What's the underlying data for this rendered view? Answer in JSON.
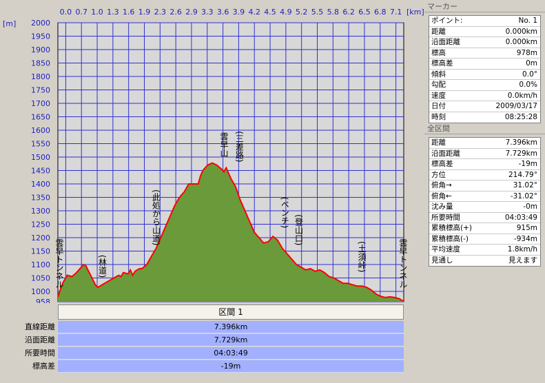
{
  "chart_data": {
    "type": "area",
    "x_unit": "[km]",
    "y_unit": "[m]",
    "x_ticks": [
      "0.0",
      "0.7",
      "1.0",
      "1.3",
      "1.6",
      "1.9",
      "2.3",
      "2.6",
      "2.9",
      "3.3",
      "3.6",
      "3.9",
      "4.2",
      "4.5",
      "4.9",
      "5.2",
      "5.5",
      "5.8",
      "6.2",
      "6.5",
      "6.8",
      "7.1"
    ],
    "y_ticks": [
      2000,
      1950,
      1900,
      1850,
      1800,
      1750,
      1700,
      1650,
      1600,
      1550,
      1500,
      1450,
      1400,
      1350,
      1300,
      1250,
      1200,
      1150,
      1100,
      1050,
      1000,
      958
    ],
    "xlim": [
      0,
      7.396
    ],
    "ylim": [
      958,
      2000
    ],
    "x": [
      0.0,
      0.1,
      0.2,
      0.3,
      0.4,
      0.5,
      0.55,
      0.6,
      0.7,
      0.8,
      0.85,
      0.9,
      1.0,
      1.1,
      1.2,
      1.3,
      1.35,
      1.4,
      1.5,
      1.55,
      1.6,
      1.65,
      1.7,
      1.75,
      1.8,
      1.9,
      2.0,
      2.1,
      2.2,
      2.3,
      2.4,
      2.5,
      2.6,
      2.7,
      2.8,
      2.9,
      3.0,
      3.05,
      3.1,
      3.2,
      3.3,
      3.4,
      3.5,
      3.55,
      3.6,
      3.65,
      3.7,
      3.8,
      3.9,
      4.0,
      4.1,
      4.2,
      4.3,
      4.4,
      4.5,
      4.6,
      4.7,
      4.8,
      4.85,
      4.9,
      5.0,
      5.1,
      5.2,
      5.3,
      5.4,
      5.5,
      5.6,
      5.7,
      5.8,
      5.9,
      6.0,
      6.1,
      6.2,
      6.3,
      6.4,
      6.5,
      6.6,
      6.7,
      6.8,
      6.9,
      7.0,
      7.1,
      7.2,
      7.3,
      7.396
    ],
    "y": [
      978,
      1030,
      1060,
      1055,
      1070,
      1090,
      1100,
      1095,
      1060,
      1025,
      1015,
      1020,
      1030,
      1040,
      1050,
      1060,
      1055,
      1070,
      1065,
      1080,
      1060,
      1075,
      1080,
      1085,
      1085,
      1100,
      1130,
      1160,
      1200,
      1240,
      1280,
      1320,
      1350,
      1370,
      1400,
      1400,
      1400,
      1430,
      1450,
      1470,
      1478,
      1470,
      1455,
      1445,
      1460,
      1440,
      1420,
      1390,
      1340,
      1300,
      1260,
      1220,
      1200,
      1180,
      1185,
      1205,
      1190,
      1160,
      1150,
      1140,
      1120,
      1100,
      1090,
      1080,
      1085,
      1075,
      1080,
      1070,
      1055,
      1050,
      1040,
      1030,
      1030,
      1025,
      1020,
      1020,
      1015,
      1005,
      990,
      980,
      975,
      978,
      975,
      970,
      959
    ],
    "annotations": [
      {
        "x": 0.03,
        "y": 990,
        "label": "雲早トンネル"
      },
      {
        "x": 0.95,
        "y": 1030,
        "label": "(林道)"
      },
      {
        "x": 2.1,
        "y": 1150,
        "label": "(此処から山道)"
      },
      {
        "x": 3.55,
        "y": 1480,
        "label": "雲早山"
      },
      {
        "x": 3.88,
        "y": 1460,
        "label": "(三差路)"
      },
      {
        "x": 4.85,
        "y": 1215,
        "label": "(ベンチ)"
      },
      {
        "x": 5.15,
        "y": 1150,
        "label": "(登山口)"
      },
      {
        "x": 6.5,
        "y": 1050,
        "label": "(土須峠)"
      },
      {
        "x": 7.38,
        "y": 990,
        "label": "雲早トンネル"
      }
    ]
  },
  "summary": {
    "header": "区間 1",
    "rows": [
      {
        "label": "直線距離",
        "value": "7.396km"
      },
      {
        "label": "沿面距離",
        "value": "7.729km"
      },
      {
        "label": "所要時間",
        "value": "04:03:49"
      },
      {
        "label": "標高差",
        "value": "-19m"
      }
    ]
  },
  "marker_panel": {
    "title": "マーカー",
    "rows": [
      {
        "label": "ポイント:",
        "value": "No. 1"
      },
      {
        "label": "距離",
        "value": "0.000km"
      },
      {
        "label": "沿面距離",
        "value": "0.000km"
      },
      {
        "label": "標高",
        "value": "978m"
      },
      {
        "label": "標高差",
        "value": "0m"
      },
      {
        "label": "傾斜",
        "value": "0.0°"
      },
      {
        "label": "勾配",
        "value": "0.0%"
      },
      {
        "label": "速度",
        "value": "0.0km/h"
      },
      {
        "label": "日付",
        "value": "2009/03/17"
      },
      {
        "label": "時刻",
        "value": "08:25:28"
      }
    ]
  },
  "section_panel": {
    "title": "全区間",
    "rows": [
      {
        "label": "距離",
        "value": "7.396km"
      },
      {
        "label": "沿面距離",
        "value": "7.729km"
      },
      {
        "label": "標高差",
        "value": "-19m"
      },
      {
        "label": "方位",
        "value": "214.79°"
      },
      {
        "label": "俯角→",
        "value": "31.02°"
      },
      {
        "label": "俯角←",
        "value": "-31.02°"
      },
      {
        "label": "沈み量",
        "value": "-0m"
      },
      {
        "label": "所要時間",
        "value": "04:03:49"
      },
      {
        "label": "累積標高(+)",
        "value": "915m"
      },
      {
        "label": "累積標高(-)",
        "value": "-934m"
      },
      {
        "label": "平均速度",
        "value": "1.8km/h"
      },
      {
        "label": "見通し",
        "value": "見えます"
      }
    ]
  },
  "colors": {
    "plot_bg": "#d8d8d8",
    "grid": "#3030d0",
    "fill": "#6a9a3a",
    "line": "#ff0000",
    "axis_text": "#2020c0",
    "summary_bg": "#a2b0ff"
  }
}
